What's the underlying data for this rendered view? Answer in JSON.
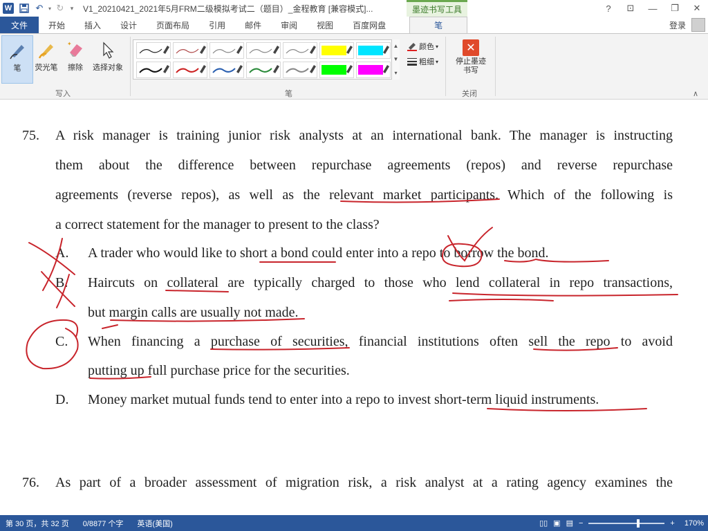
{
  "titlebar": {
    "app_icon": "W",
    "save_icon": "save-icon",
    "undo_icon": "undo-icon",
    "redo_icon": "redo-icon",
    "document_title": "V1_20210421_2021年5月FRM二级模拟考试二（题目）_金程教育 [兼容模式]...",
    "context_tab_title": "墨迹书写工具",
    "help": "?",
    "ribbon_display": "⊡",
    "minimize": "—",
    "restore": "❐",
    "close": "✕"
  },
  "tabs": {
    "file": "文件",
    "items": [
      "开始",
      "插入",
      "设计",
      "页面布局",
      "引用",
      "邮件",
      "审阅",
      "视图",
      "百度网盘"
    ],
    "active": "笔",
    "login": "登录"
  },
  "ribbon": {
    "write_group": {
      "label": "写入",
      "buttons": [
        {
          "label": "笔",
          "icon": "pen-icon"
        },
        {
          "label": "荧光笔",
          "icon": "highlighter-icon"
        },
        {
          "label": "擦除",
          "icon": "eraser-icon"
        },
        {
          "label": "选择对象",
          "icon": "select-arrow-icon"
        }
      ]
    },
    "pens_group": {
      "label": "笔",
      "row1_colors": [
        "#222222",
        "#b04a4a",
        "#888888",
        "#888888",
        "#888888",
        "#ffff00",
        "#00e5ff"
      ],
      "row2_colors": [
        "#111111",
        "#cc2222",
        "#2a5fb0",
        "#2a8a3a",
        "#888888",
        "#00ff00",
        "#ff00ff"
      ],
      "color_cmd": "颜色",
      "thickness_cmd": "粗细"
    },
    "close_group": {
      "label": "关闭",
      "stop_label": "停止墨迹书写"
    }
  },
  "document": {
    "q75": {
      "number": "75.",
      "lines": [
        "A risk manager is training junior risk analysts at an international bank. The manager is instructing",
        "them about the difference between repurchase agreements (repos) and reverse repurchase",
        "agreements (reverse repos), as well as the relevant market participants. Which of the following is",
        "a correct statement for the manager to present to the class?"
      ],
      "options": [
        {
          "letter": "A.",
          "lines": [
            "A trader who would like to short a bond could enter into a repo to borrow the bond."
          ]
        },
        {
          "letter": "B.",
          "lines": [
            "Haircuts on collateral are typically charged to those who lend collateral in repo transactions,",
            "but margin calls are usually not made."
          ]
        },
        {
          "letter": "C.",
          "lines": [
            "When financing a purchase of securities, financial institutions often sell the repo to avoid",
            "putting up full purchase price for the securities."
          ]
        },
        {
          "letter": "D.",
          "lines": [
            "Money market mutual funds tend to enter into a repo to invest short-term liquid instruments."
          ]
        }
      ]
    },
    "q76": {
      "number": "76.",
      "line": "As part of a broader assessment of migration risk, a risk analyst at a rating agency examines the"
    }
  },
  "statusbar": {
    "page": "第 30 页，共 32 页",
    "words": "0/8877 个字",
    "language": "英语(美国)",
    "zoom_minus": "−",
    "zoom_plus": "+",
    "zoom": "170%"
  }
}
